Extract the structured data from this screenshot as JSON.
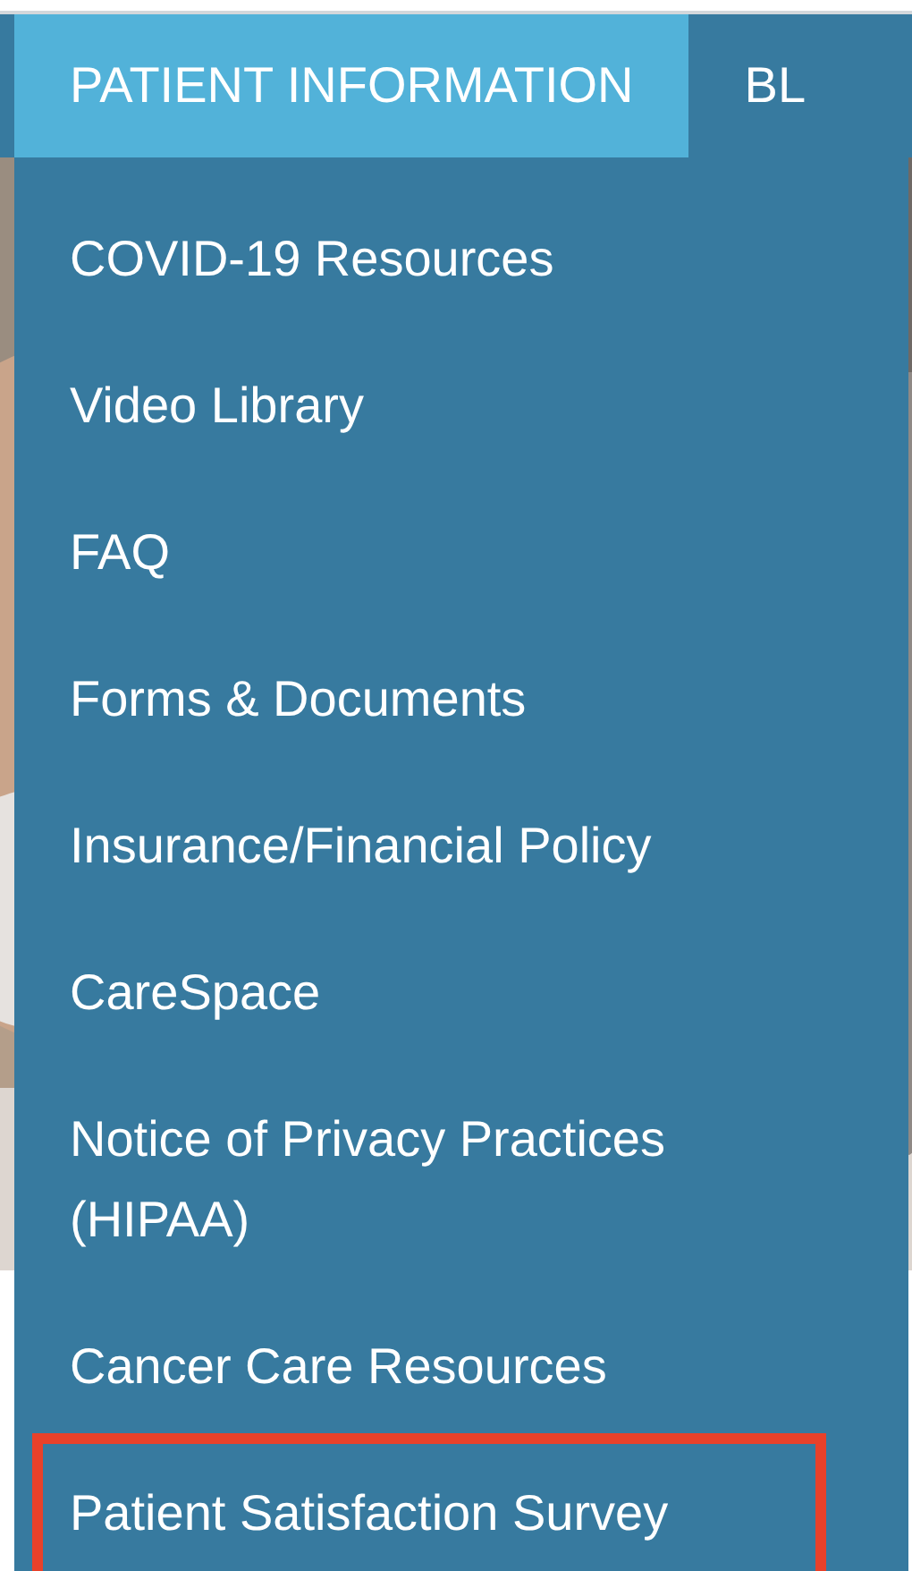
{
  "nav": {
    "tabs": [
      {
        "label": "PATIENT INFORMATION",
        "selected": true
      },
      {
        "label": "BL",
        "selected": false
      }
    ]
  },
  "dropdown": {
    "items": [
      {
        "label": "COVID-19 Resources",
        "highlighted": false
      },
      {
        "label": "Video Library",
        "highlighted": false
      },
      {
        "label": "FAQ",
        "highlighted": false
      },
      {
        "label": "Forms & Documents",
        "highlighted": false
      },
      {
        "label": "Insurance/Financial Policy",
        "highlighted": false
      },
      {
        "label": "CareSpace",
        "highlighted": false
      },
      {
        "label": "Notice of Privacy Practices (HIPAA)",
        "highlighted": false
      },
      {
        "label": "Cancer Care Resources",
        "highlighted": false
      },
      {
        "label": "Patient Satisfaction Survey",
        "highlighted": true
      }
    ]
  }
}
